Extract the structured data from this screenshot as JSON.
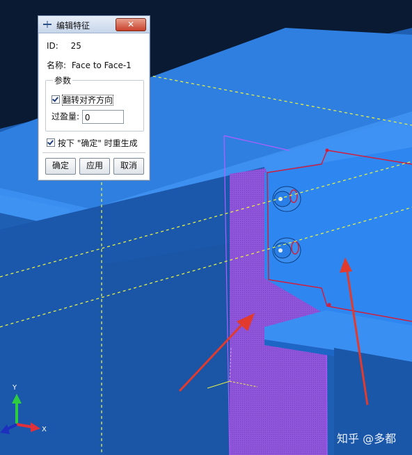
{
  "dialog": {
    "title": "编辑特征",
    "close_label": "✕",
    "id_label": "ID:",
    "id_value": "25",
    "name_label": "名称:",
    "name_value": "Face to Face-1",
    "params_legend": "参数",
    "flip_label": "翻转对齐方向",
    "flip_checked": true,
    "clearance_label": "过盈量:",
    "clearance_value": "0",
    "regen_label": "按下 \"确定\" 时重生成",
    "regen_checked": true,
    "ok_label": "确定",
    "apply_label": "应用",
    "cancel_label": "取消"
  },
  "axes": {
    "y": "Y",
    "x": "X"
  },
  "watermark": "知乎 @多都",
  "colors": {
    "background": "#1e5fb3",
    "plate": "#3d8fee",
    "highlight_face": "#8f4fd6",
    "constraint_line": "#d21e3c",
    "dashed_guides": "#e6ef45",
    "arrows": "#e23a2c"
  }
}
